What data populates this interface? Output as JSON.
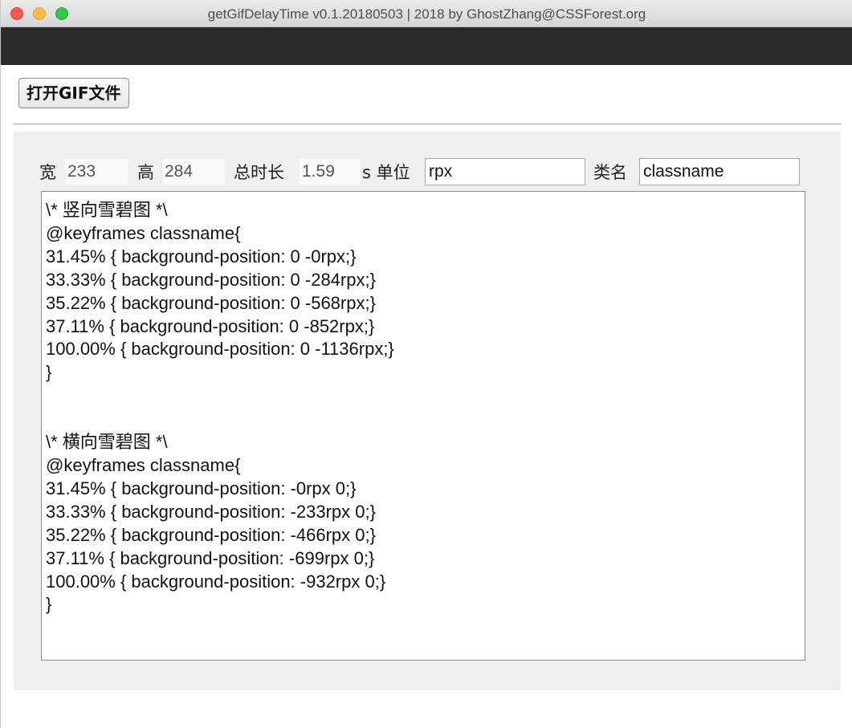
{
  "window": {
    "title": "getGifDelayTime v0.1.20180503 | 2018 by GhostZhang@CSSForest.org"
  },
  "toolbar": {
    "open_gif_label": "打开GIF文件"
  },
  "fields": {
    "width_label": "宽",
    "width_value": "233",
    "height_label": "高",
    "height_value": "284",
    "duration_label": "总时长",
    "duration_value": "1.59",
    "unit_label": "s 单位",
    "unit_value": "rpx",
    "classname_label": "类名",
    "classname_value": "classname"
  },
  "output": {
    "code": "\\* 竖向雪碧图 *\\\n@keyframes classname{\n31.45% { background-position: 0 -0rpx;}\n33.33% { background-position: 0 -284rpx;}\n35.22% { background-position: 0 -568rpx;}\n37.11% { background-position: 0 -852rpx;}\n100.00% { background-position: 0 -1136rpx;}\n}\n\n\n\\* 横向雪碧图 *\\\n@keyframes classname{\n31.45% { background-position: -0rpx 0;}\n33.33% { background-position: -233rpx 0;}\n35.22% { background-position: -466rpx 0;}\n37.11% { background-position: -699rpx 0;}\n100.00% { background-position: -932rpx 0;}\n}"
  }
}
